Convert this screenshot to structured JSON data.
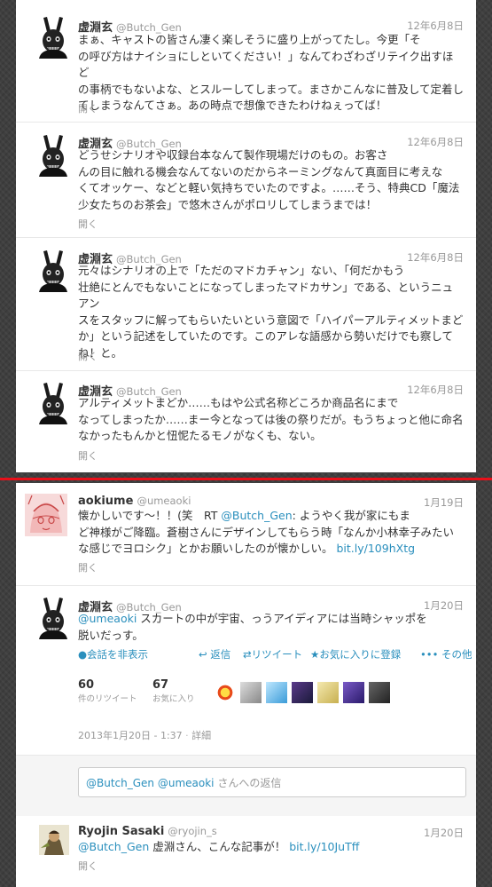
{
  "tweets_top": [
    {
      "fullname": "虚淵玄",
      "handle": "@Butch_Gen",
      "date": "12年6月8日",
      "lines": [
        "まぁ、キャストの皆さん凄く楽しそうに盛り上がってたし。今更「そ",
        "の呼び方はナイショにしといてください！」なんてわざわざリテイク出すほど",
        "の事柄でもないよな、とスルーしてしまって。まさかこんなに普及して定着し",
        "てしまうなんてさぁ。あの時点で想像できたわけねぇってば！"
      ],
      "open": "開く"
    },
    {
      "fullname": "虚淵玄",
      "handle": "@Butch_Gen",
      "date": "12年6月8日",
      "lines": [
        "どうせシナリオや収録台本なんて製作現場だけのもの。お客さ",
        "んの目に触れる機会なんてないのだからネーミングなんて真面目に考えな",
        "くてオッケー、などと軽い気持ちでいたのですよ。……そう、特典CD「魔法",
        "少女たちのお茶会」で悠木さんがポロリしてしまうまでは！"
      ],
      "open": "開く"
    },
    {
      "fullname": "虚淵玄",
      "handle": "@Butch_Gen",
      "date": "12年6月8日",
      "lines": [
        "元々はシナリオの上で「ただのマドカチャン」ない、「何だかもう",
        "壮絶にとんでもないことになってしまったマドカサン」である、というニュアン",
        "スをスタッフに解ってもらいたいという意図で「ハイパーアルティメットまど",
        "か」という記述をしていたのです。このアレな語感から勢いだけでも察して",
        "ね！と。"
      ],
      "open": "開く"
    },
    {
      "fullname": "虚淵玄",
      "handle": "@Butch_Gen",
      "date": "12年6月8日",
      "lines": [
        "アルティメットまどか……もはや公式名称どころか商品名にまで",
        "なってしまったか……まー今となっては後の祭りだが。もうちょっと他に命名",
        "なかったもんかと忸怩たるモノがなくも、ない。"
      ],
      "open": "開く"
    }
  ],
  "aoki_tweet": {
    "fullname": "aokiume",
    "handle": "@umeaoki",
    "date": "1月19日",
    "line1_a": "懐かしいです〜！！(笑　RT ",
    "line1_mention": "@Butch_Gen",
    "line1_b": ": ようやく我が家にもま",
    "line2": "ど神様がご降臨。蒼樹さんにデザインしてもらう時「なんか小林幸子みたい",
    "line3_a": "な感じでヨロシク」とかお願いしたのが懐かしい。 ",
    "line3_link": "bit.ly/109hXtg",
    "open": "開く"
  },
  "selected_tweet": {
    "fullname": "虚淵玄",
    "handle": "@Butch_Gen",
    "date": "1月20日",
    "mention": "@umeaoki",
    "line1_rest": " スカートの中が宇宙、っうアイディアには当時シャッポを",
    "line2": "脱いだっす。",
    "actions": {
      "hide_conversation": "会話を非表示",
      "reply": "返信",
      "retweet": "リツイート",
      "favorite": "お気に入りに登録",
      "more": "その他"
    },
    "retweets": {
      "count": "60",
      "label": "件のリツイート"
    },
    "favorites": {
      "count": "67",
      "label": "お気に入り"
    },
    "timestamp": "2013年1月20日 - 1:37",
    "details": "詳細",
    "reply_placeholder_mentions": "@Butch_Gen @umeaoki",
    "reply_placeholder_rest": " さんへの返信"
  },
  "ryojin_tweet": {
    "fullname": "Ryojin Sasaki",
    "handle": "@ryojin_s",
    "date": "1月20日",
    "mention": "@Butch_Gen",
    "text": " 虚淵さん、こんな記事が！  ",
    "link": "bit.ly/10JuTff",
    "open": "開く"
  },
  "colors": {
    "link": "#2a8fbd",
    "divider": "#e8101a",
    "background": "#3f3f3f"
  }
}
